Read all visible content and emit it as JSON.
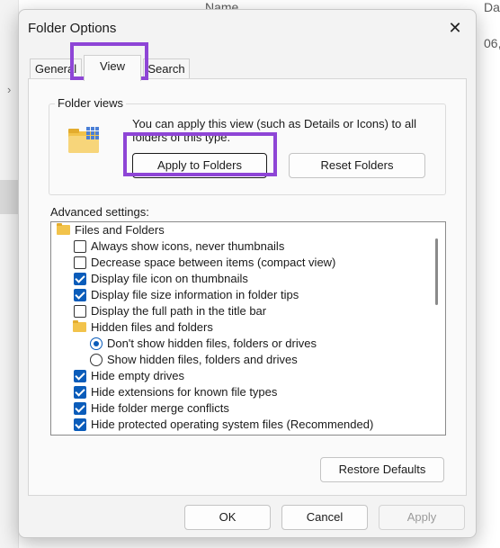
{
  "background": {
    "column_name": "Name",
    "column_date": "Da",
    "date_value": "06,",
    "chevron": "›"
  },
  "dialog": {
    "title": "Folder Options",
    "close_glyph": "✕",
    "tabs": [
      {
        "label": "General",
        "selected": false
      },
      {
        "label": "View",
        "selected": true
      },
      {
        "label": "Search",
        "selected": false
      }
    ],
    "folder_views": {
      "legend": "Folder views",
      "description": "You can apply this view (such as Details or Icons) to all folders of this type.",
      "apply_button": "Apply to Folders",
      "reset_button": "Reset Folders"
    },
    "advanced": {
      "label": "Advanced settings:",
      "items": [
        {
          "type": "folder",
          "label": "Files and Folders",
          "indent": 0
        },
        {
          "type": "checkbox",
          "label": "Always show icons, never thumbnails",
          "checked": false,
          "indent": 1
        },
        {
          "type": "checkbox",
          "label": "Decrease space between items (compact view)",
          "checked": false,
          "indent": 1
        },
        {
          "type": "checkbox",
          "label": "Display file icon on thumbnails",
          "checked": true,
          "indent": 1
        },
        {
          "type": "checkbox",
          "label": "Display file size information in folder tips",
          "checked": true,
          "indent": 1
        },
        {
          "type": "checkbox",
          "label": "Display the full path in the title bar",
          "checked": false,
          "indent": 1
        },
        {
          "type": "folder",
          "label": "Hidden files and folders",
          "indent": 1
        },
        {
          "type": "radio",
          "label": "Don't show hidden files, folders or drives",
          "checked": true,
          "indent": 2
        },
        {
          "type": "radio",
          "label": "Show hidden files, folders and drives",
          "checked": false,
          "indent": 2
        },
        {
          "type": "checkbox",
          "label": "Hide empty drives",
          "checked": true,
          "indent": 1
        },
        {
          "type": "checkbox",
          "label": "Hide extensions for known file types",
          "checked": true,
          "indent": 1
        },
        {
          "type": "checkbox",
          "label": "Hide folder merge conflicts",
          "checked": true,
          "indent": 1
        },
        {
          "type": "checkbox",
          "label": "Hide protected operating system files (Recommended)",
          "checked": true,
          "indent": 1
        },
        {
          "type": "checkbox",
          "label": "",
          "checked": true,
          "indent": 1
        }
      ],
      "restore_button": "Restore Defaults"
    },
    "buttons": {
      "ok": "OK",
      "cancel": "Cancel",
      "apply": "Apply"
    }
  },
  "colors": {
    "highlight": "#8e45d6",
    "accent": "#0a5cba",
    "folder": "#f2c34b"
  }
}
